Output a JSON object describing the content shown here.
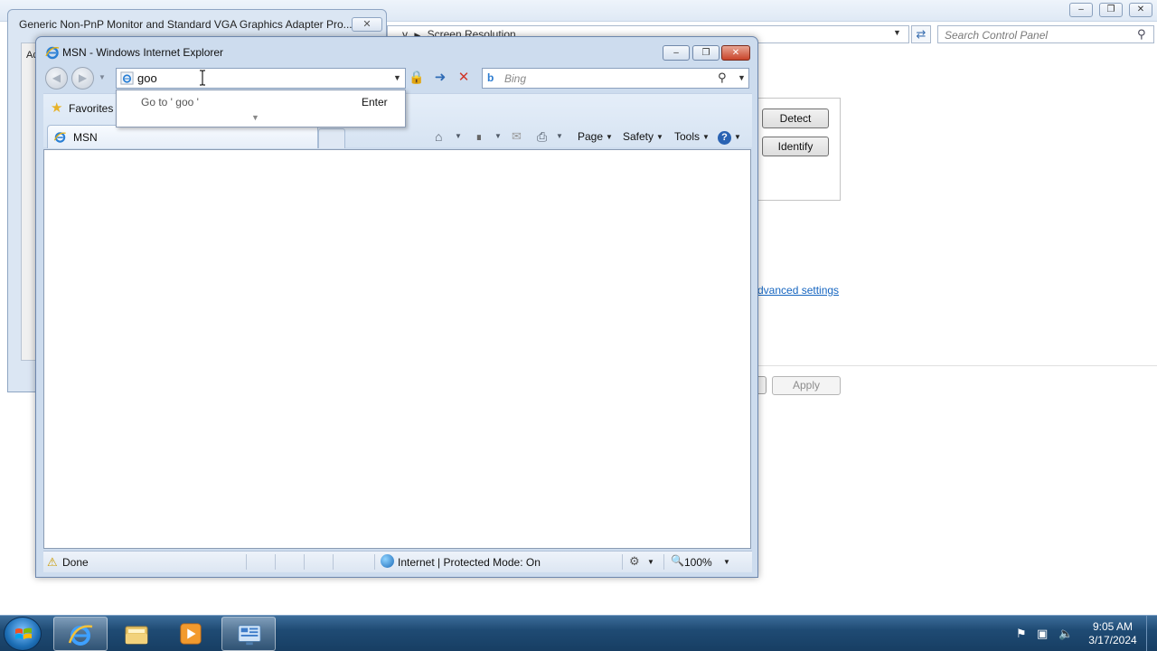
{
  "control_panel": {
    "breadcrumb_partial": "y",
    "breadcrumb_current": "Screen Resolution",
    "search_placeholder": "Search Control Panel",
    "detect_label": "Detect",
    "identify_label": "Identify",
    "advanced_link": "Advanced settings",
    "advanced_link_visible": "dvanced settings",
    "apply_label": "Apply"
  },
  "properties_dialog": {
    "title": "Generic Non-PnP Monitor and Standard VGA Graphics Adapter Pro...",
    "inner_tab": "Ac"
  },
  "ie": {
    "title": "MSN - Windows Internet Explorer",
    "address_value": "goo",
    "search_placeholder": "Bing",
    "favorites_label": "Favorites",
    "tab_label": "MSN",
    "menus": {
      "page": "Page",
      "safety": "Safety",
      "tools": "Tools"
    },
    "autocomplete": {
      "goto_text": "Go to '  goo  '",
      "enter_label": "Enter"
    },
    "status": {
      "done": "Done",
      "zone": "Internet | Protected Mode: On",
      "zoom": "100%"
    }
  },
  "taskbar": {
    "time": "9:05 AM",
    "date": "3/17/2024",
    "pinned": [
      "internet-explorer",
      "windows-explorer",
      "media-player",
      "control-panel"
    ]
  },
  "colors": {
    "link": "#1565c0",
    "taskbar": "#1f4b74",
    "ie_frame": "#cddcee"
  }
}
